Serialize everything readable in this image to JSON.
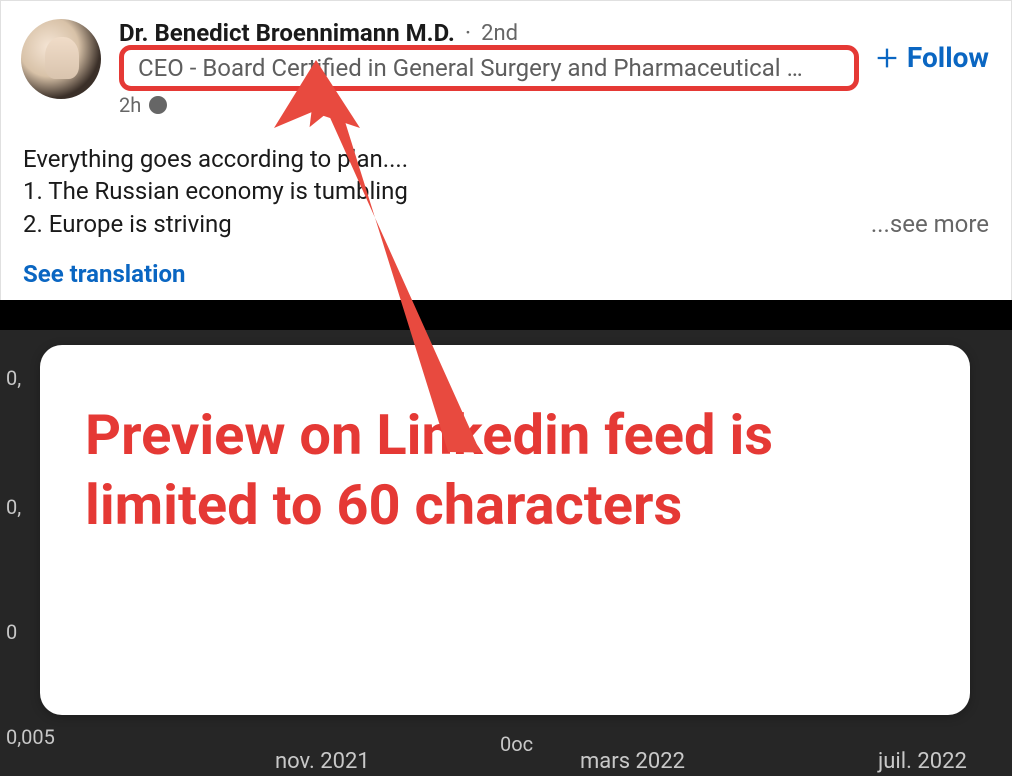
{
  "post": {
    "author": {
      "name": "Dr. Benedict Broennimann M.D.",
      "degree": "2nd",
      "headline": "CEO - Board Certified in General Surgery and Pharmaceutical …",
      "timestamp": "2h",
      "visibility": "globe"
    },
    "follow_label": "Follow",
    "body": {
      "line1": "Everything goes according to plan....",
      "line2": "1. The Russian economy is tumbling",
      "line3": "2. Europe is striving"
    },
    "see_more": "...see more",
    "see_translation": "See translation"
  },
  "annotation": {
    "callout": "Preview on Linkedin feed is limited to 60 characters",
    "highlight_color": "#e53935"
  },
  "chart_data": {
    "type": "line",
    "y_ticks": [
      "0,",
      "0,",
      "0",
      "0,005"
    ],
    "x_ticks": [
      "nov. 2021",
      "mars 2022",
      "juil. 2022"
    ],
    "x_minor": "0oc"
  }
}
